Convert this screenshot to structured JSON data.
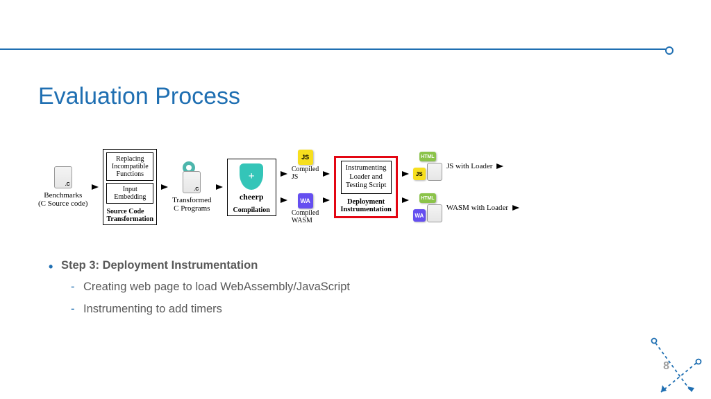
{
  "title": "Evaluation Process",
  "page_number": "8",
  "diagram": {
    "benchmarks": {
      "label": "Benchmarks",
      "sub": "(C Source code)",
      "ext": ".C"
    },
    "sct": {
      "box1": "Replacing\nIncompatible\nFunctions",
      "box2": "Input\nEmbedding",
      "caption": "Source Code\nTransformation"
    },
    "transformed": {
      "label": "Transformed\nC Programs",
      "ext": ".C"
    },
    "compile": {
      "tool": "cheerp",
      "caption": "Compilation"
    },
    "outputs": {
      "js": {
        "badge": "JS",
        "label": "Compiled\nJS"
      },
      "wa": {
        "badge": "WA",
        "label": "Compiled\nWASM"
      }
    },
    "deploy": {
      "sub": "Instrumenting\nLoader and\nTesting Script",
      "caption": "Deployment\nInstrumentation"
    },
    "results": {
      "html_badge": "HTML",
      "js": "JS with Loader",
      "wa": "WASM with Loader"
    }
  },
  "bullets": {
    "step_title": "Step 3: Deployment Instrumentation",
    "sub1": "Creating web page to load WebAssembly/JavaScript",
    "sub2": "Instrumenting to add timers"
  }
}
